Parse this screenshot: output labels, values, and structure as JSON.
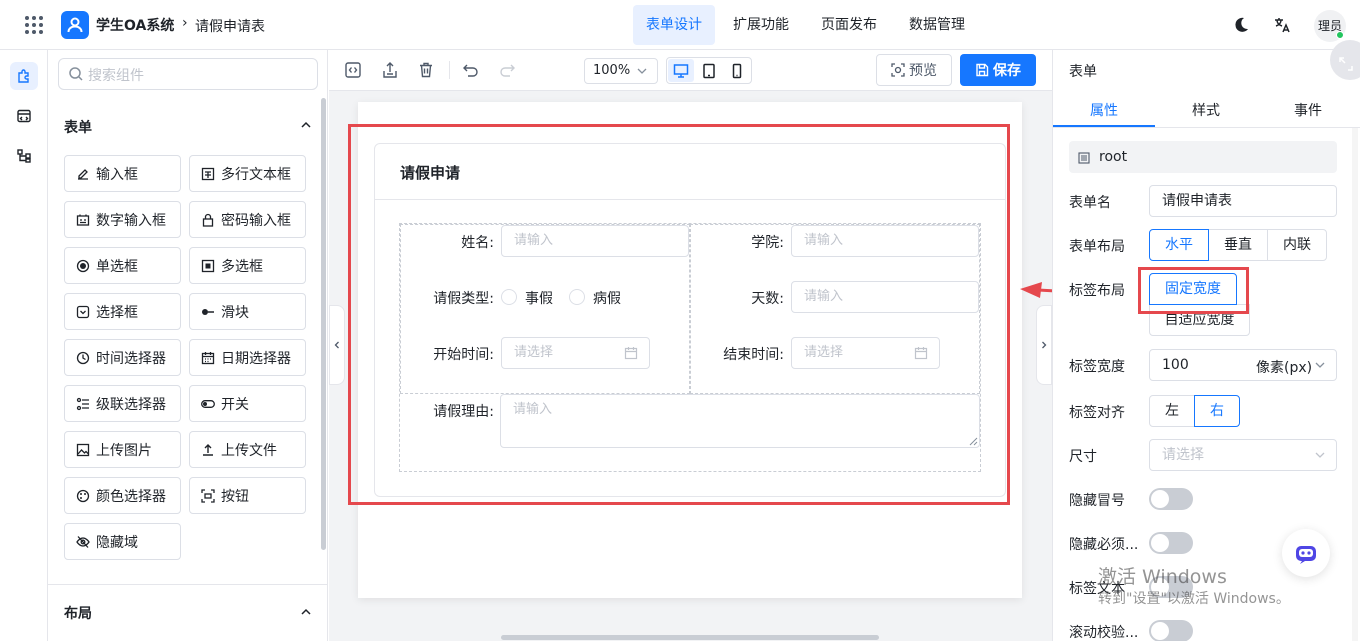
{
  "topbar": {
    "app_title": "学生OA系统",
    "breadcrumb_sep": "›",
    "breadcrumb": "请假申请表",
    "nav_tabs": [
      {
        "label": "表单设计",
        "active": true
      },
      {
        "label": "扩展功能",
        "active": false
      },
      {
        "label": "页面发布",
        "active": false
      },
      {
        "label": "数据管理",
        "active": false
      }
    ],
    "avatar_text": "理员",
    "icons": [
      "apps-grid-icon",
      "user-logo-icon",
      "moon-icon",
      "translate-icon"
    ]
  },
  "rail": {
    "items": [
      {
        "icon": "puzzle-icon",
        "active": true
      },
      {
        "icon": "code-icon",
        "active": false
      },
      {
        "icon": "tree-icon",
        "active": false
      }
    ]
  },
  "components": {
    "search_placeholder": "搜索组件",
    "form_section": "表单",
    "layout_section": "布局",
    "items": [
      {
        "label": "输入框",
        "icon": "edit-icon"
      },
      {
        "label": "多行文本框",
        "icon": "textarea-icon"
      },
      {
        "label": "数字输入框",
        "icon": "number-icon"
      },
      {
        "label": "密码输入框",
        "icon": "lock-icon"
      },
      {
        "label": "单选框",
        "icon": "radio-icon"
      },
      {
        "label": "多选框",
        "icon": "checkbox-icon"
      },
      {
        "label": "选择框",
        "icon": "select-icon"
      },
      {
        "label": "滑块",
        "icon": "slider-icon"
      },
      {
        "label": "时间选择器",
        "icon": "clock-icon"
      },
      {
        "label": "日期选择器",
        "icon": "calendar-icon"
      },
      {
        "label": "级联选择器",
        "icon": "cascader-icon"
      },
      {
        "label": "开关",
        "icon": "switch-icon"
      },
      {
        "label": "上传图片",
        "icon": "image-icon"
      },
      {
        "label": "上传文件",
        "icon": "upload-icon"
      },
      {
        "label": "颜色选择器",
        "icon": "palette-icon"
      },
      {
        "label": "按钮",
        "icon": "button-icon"
      },
      {
        "label": "隐藏域",
        "icon": "eye-off-icon"
      }
    ]
  },
  "toolbar": {
    "zoom": "100%",
    "preview_label": "预览",
    "save_label": "保存"
  },
  "form": {
    "title": "请假申请",
    "fields": {
      "name": {
        "label": "姓名:",
        "placeholder": "请输入"
      },
      "college": {
        "label": "学院:",
        "placeholder": "请输入"
      },
      "leave_type": {
        "label": "请假类型:",
        "options": [
          "事假",
          "病假"
        ]
      },
      "days": {
        "label": "天数:",
        "placeholder": "请输入"
      },
      "start": {
        "label": "开始时间:",
        "placeholder": "请选择"
      },
      "end": {
        "label": "结束时间:",
        "placeholder": "请选择"
      },
      "reason": {
        "label": "请假理由:",
        "placeholder": "请输入"
      }
    }
  },
  "props": {
    "panel_title": "表单",
    "tabs": [
      {
        "label": "属性",
        "active": true
      },
      {
        "label": "样式",
        "active": false
      },
      {
        "label": "事件",
        "active": false
      }
    ],
    "root": "root",
    "form_name_label": "表单名",
    "form_name_value": "请假申请表",
    "form_layout_label": "表单布局",
    "form_layout_options": [
      "水平",
      "垂直",
      "内联"
    ],
    "label_layout_label": "标签布局",
    "label_layout_options": [
      "固定宽度",
      "自适应宽度"
    ],
    "label_width_label": "标签宽度",
    "label_width_value": "100",
    "label_width_unit": "像素(px)",
    "label_align_label": "标签对齐",
    "label_align_options": [
      "左",
      "右"
    ],
    "size_label": "尺寸",
    "size_placeholder": "请选择",
    "hide_colon_label": "隐藏冒号",
    "hide_required_label": "隐藏必须...",
    "label_text_label": "标签文本",
    "scroll_validate_label": "滚动校验..."
  },
  "watermark": {
    "line1": "激活 Windows",
    "line2": "转到\"设置\"以激活 Windows。"
  },
  "colors": {
    "primary": "#1677ff",
    "highlight_red": "#e5484d"
  }
}
